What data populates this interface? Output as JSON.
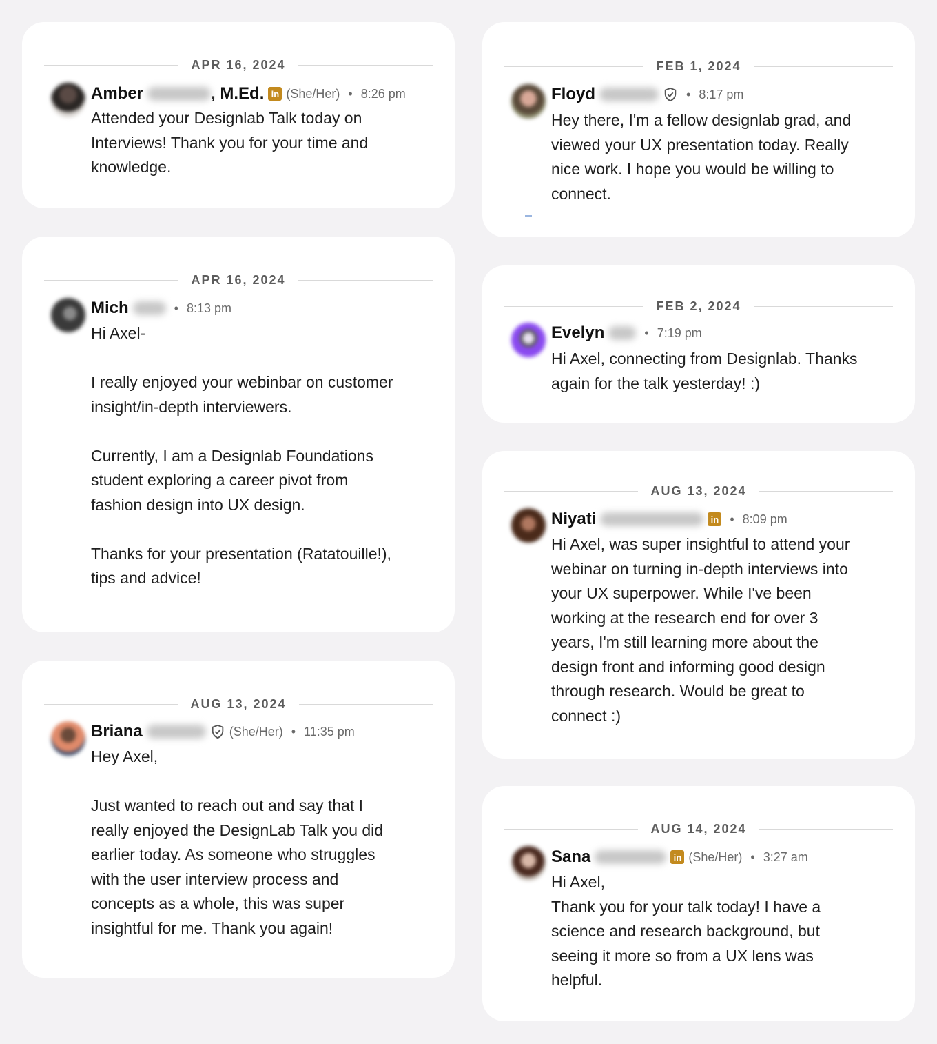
{
  "cards": [
    {
      "date": "APR 16, 2024",
      "first_name": "Amber",
      "suffix": ", M.Ed.",
      "badge": "linkedin-premium-icon",
      "pronouns": "(She/Her)",
      "time": "8:26 pm",
      "lines": [
        "Attended your Designlab Talk today on",
        "Interviews! Thank you for your time and",
        "knowledge."
      ]
    },
    {
      "date": "APR 16, 2024",
      "first_name": "Mich",
      "time": "8:13 pm",
      "lines": [
        "Hi Axel-",
        "",
        "I really enjoyed your webinbar on customer",
        "insight/in-depth interviewers.",
        "",
        "Currently, I am a Designlab Foundations",
        "student exploring a career pivot from",
        "fashion design into UX design.",
        "",
        "Thanks for your presentation (Ratatouille!),",
        "tips and advice!"
      ]
    },
    {
      "date": "AUG 13, 2024",
      "first_name": "Briana",
      "badge": "verified-shield-icon",
      "pronouns": "(She/Her)",
      "time": "11:35 pm",
      "lines": [
        "Hey Axel,",
        "",
        "Just wanted to reach out and say that I",
        "really enjoyed the DesignLab Talk you did",
        "earlier today. As someone who struggles",
        "with the user interview process and",
        "concepts as a whole, this was super",
        "insightful for me. Thank you again!"
      ]
    },
    {
      "date": "FEB 1, 2024",
      "first_name": "Floyd",
      "badge": "verified-shield-icon",
      "time": "8:17 pm",
      "lines": [
        "Hey there, I'm a fellow designlab grad, and",
        "viewed your UX presentation today. Really",
        "nice work. I hope you would be willing to",
        "connect."
      ]
    },
    {
      "date": "FEB 2, 2024",
      "first_name": "Evelyn",
      "time": "7:19 pm",
      "lines": [
        "Hi Axel, connecting from Designlab. Thanks",
        "again for the talk yesterday! :)"
      ]
    },
    {
      "date": "AUG 13, 2024",
      "first_name": "Niyati",
      "badge": "linkedin-premium-icon",
      "time": "8:09 pm",
      "lines": [
        "Hi Axel, was super insightful to attend your",
        "webinar on turning in-depth interviews into",
        "your UX superpower. While I've been",
        "working at the research end for over 3",
        "years, I'm still learning more about the",
        "design front and informing good design",
        "through research. Would be great to",
        "connect :)"
      ]
    },
    {
      "date": "AUG 14, 2024",
      "first_name": "Sana",
      "badge": "linkedin-premium-icon",
      "pronouns": "(She/Her)",
      "time": "3:27 am",
      "lines": [
        "Hi Axel,",
        "Thank you for your talk today! I have a",
        "science and research background, but",
        "seeing it more so from a UX lens was",
        "helpful."
      ]
    }
  ],
  "linkedin_badge_text": "in",
  "colors": {
    "background": "#f3f2f4",
    "card": "#ffffff",
    "linkedin_gold": "#c38a1e",
    "meta_gray": "#6a6a6a"
  }
}
